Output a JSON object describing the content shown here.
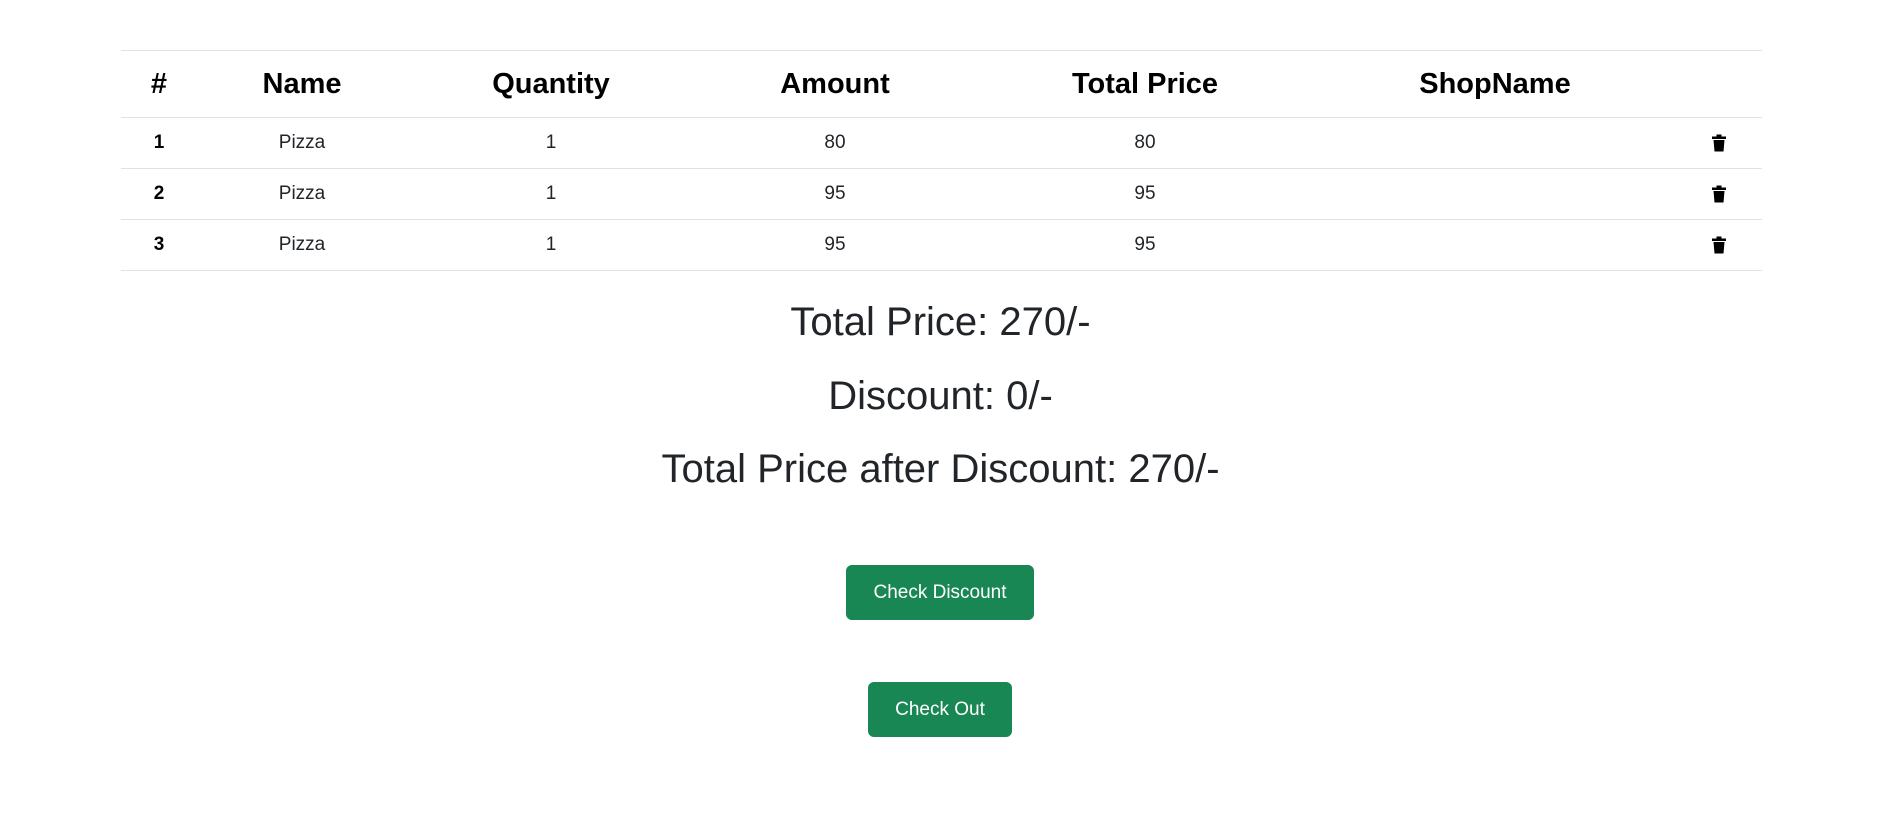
{
  "table": {
    "headers": [
      "#",
      "Name",
      "Quantity",
      "Amount",
      "Total Price",
      "ShopName"
    ],
    "rows": [
      {
        "num": "1",
        "name": "Pizza",
        "quantity": "1",
        "amount": "80",
        "total": "80",
        "shop": ""
      },
      {
        "num": "2",
        "name": "Pizza",
        "quantity": "1",
        "amount": "95",
        "total": "95",
        "shop": ""
      },
      {
        "num": "3",
        "name": "Pizza",
        "quantity": "1",
        "amount": "95",
        "total": "95",
        "shop": ""
      }
    ],
    "row_action_icon": "trash-icon"
  },
  "summary": {
    "total_price": "Total Price: 270/-",
    "discount": "Discount: 0/-",
    "total_after_discount": "Total Price after Discount: 270/-"
  },
  "buttons": {
    "check_discount": "Check Discount",
    "check_out": "Check Out"
  },
  "colors": {
    "button_bg": "#198754",
    "button_text": "#ffffff",
    "border": "#dee2e6",
    "text": "#212529"
  }
}
